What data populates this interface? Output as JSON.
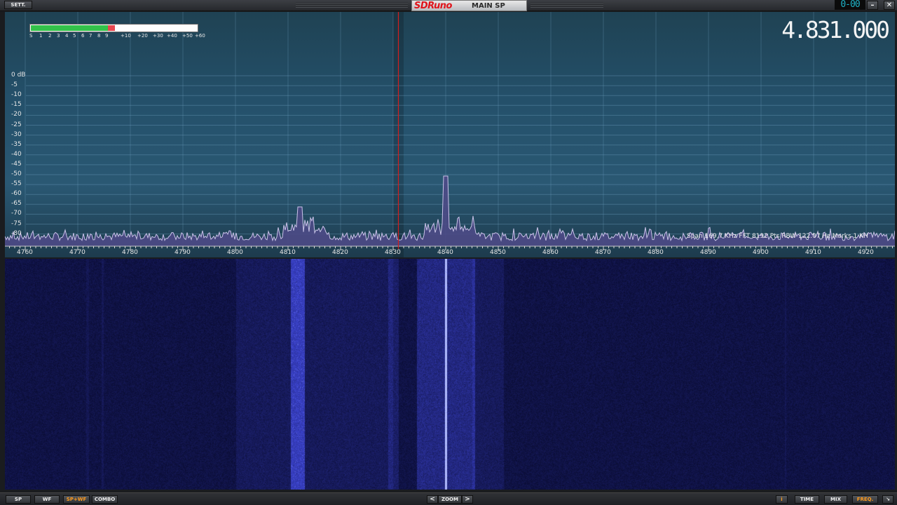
{
  "titlebar": {
    "settings_label": "SETT.",
    "app_logo": "SDRuno",
    "window_title": "MAIN SP",
    "clock": "0-00",
    "minimize_glyph": "–",
    "close_glyph": "✕"
  },
  "smeter": {
    "level_fraction": 0.5,
    "scale_labels": [
      "S",
      "1",
      "2",
      "3",
      "4",
      "5",
      "6",
      "7",
      "8",
      "9",
      "+10",
      "+20",
      "+30",
      "+40",
      "+50",
      "+60"
    ]
  },
  "frequency_display": "4.831.000",
  "spectrum": {
    "db_labels": [
      "0 dB",
      "-5",
      "-10",
      "-15",
      "-20",
      "-25",
      "-30",
      "-35",
      "-40",
      "-45",
      "-50",
      "-55",
      "-60",
      "-65",
      "-70",
      "-75",
      "-80"
    ],
    "freq_labels": [
      "4760",
      "4770",
      "4780",
      "4790",
      "4800",
      "4810",
      "4820",
      "4830",
      "4840",
      "4850",
      "4860",
      "4870",
      "4880",
      "4890",
      "4900",
      "4910",
      "4920"
    ],
    "span_info": "Span 169.7 KHz   FFT 8192 Pts   RBW 122.07 Hz   Marks 1 KH",
    "vfo_freq_khz": 4831,
    "colors": {
      "trace": "#c9c3e8",
      "fill": "#4d4a86",
      "vfo_line": "#d21e1e"
    }
  },
  "bottombar": {
    "sp": "SP",
    "wf": "WF",
    "sp_wf": "SP+WF",
    "combo": "COMBO",
    "zoom_left": "<",
    "zoom_label": "ZOOM",
    "zoom_right": ">",
    "info": "i",
    "time": "TIME",
    "mix": "MIX",
    "freq": "FREQ.",
    "corner_glyph": "↘",
    "active": "sp_wf"
  }
}
